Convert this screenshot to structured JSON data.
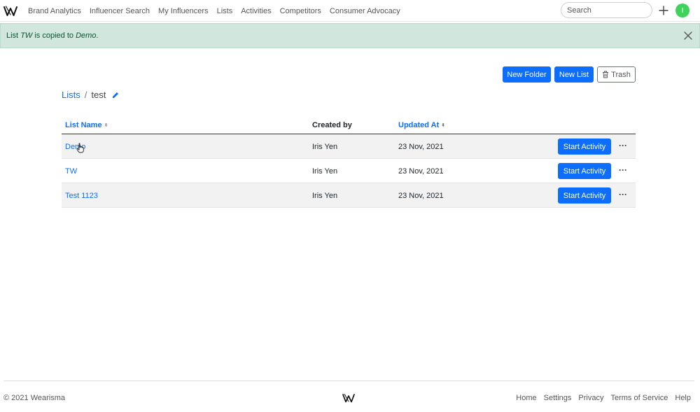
{
  "nav": {
    "items": [
      {
        "label": "Brand Analytics"
      },
      {
        "label": "Influencer Search"
      },
      {
        "label": "My Influencers"
      },
      {
        "label": "Lists"
      },
      {
        "label": "Activities"
      },
      {
        "label": "Competitors"
      },
      {
        "label": "Consumer Advocacy"
      }
    ],
    "search_placeholder": "Search",
    "avatar_initial": "I",
    "avatar_color": "#3fd35c"
  },
  "alert": {
    "prefix": "List ",
    "list_name": "TW",
    "middle": " is copied to ",
    "target": "Demo",
    "suffix": ".",
    "bg_color": "#d1e7dd"
  },
  "actions": {
    "new_folder": "New Folder",
    "new_list": "New List",
    "trash": "Trash"
  },
  "breadcrumb": {
    "root": "Lists",
    "separator": "/",
    "current": "test"
  },
  "table": {
    "headers": {
      "name": "List Name",
      "created_by": "Created by",
      "updated_at": "Updated At"
    },
    "rows": [
      {
        "name": "Demo",
        "created_by": "Iris Yen",
        "updated_at": "23 Nov, 2021",
        "action": "Start Activity"
      },
      {
        "name": "TW",
        "created_by": "Iris Yen",
        "updated_at": "23 Nov, 2021",
        "action": "Start Activity"
      },
      {
        "name": "Test 1123",
        "created_by": "Iris Yen",
        "updated_at": "23 Nov, 2021",
        "action": "Start Activity"
      }
    ]
  },
  "footer": {
    "copyright": "© 2021 Wearisma",
    "links": [
      {
        "label": "Home"
      },
      {
        "label": "Settings"
      },
      {
        "label": "Privacy"
      },
      {
        "label": "Terms of Service"
      },
      {
        "label": "Help"
      }
    ]
  },
  "colors": {
    "primary": "#0d6efd",
    "text": "#212529",
    "muted": "#555555"
  }
}
